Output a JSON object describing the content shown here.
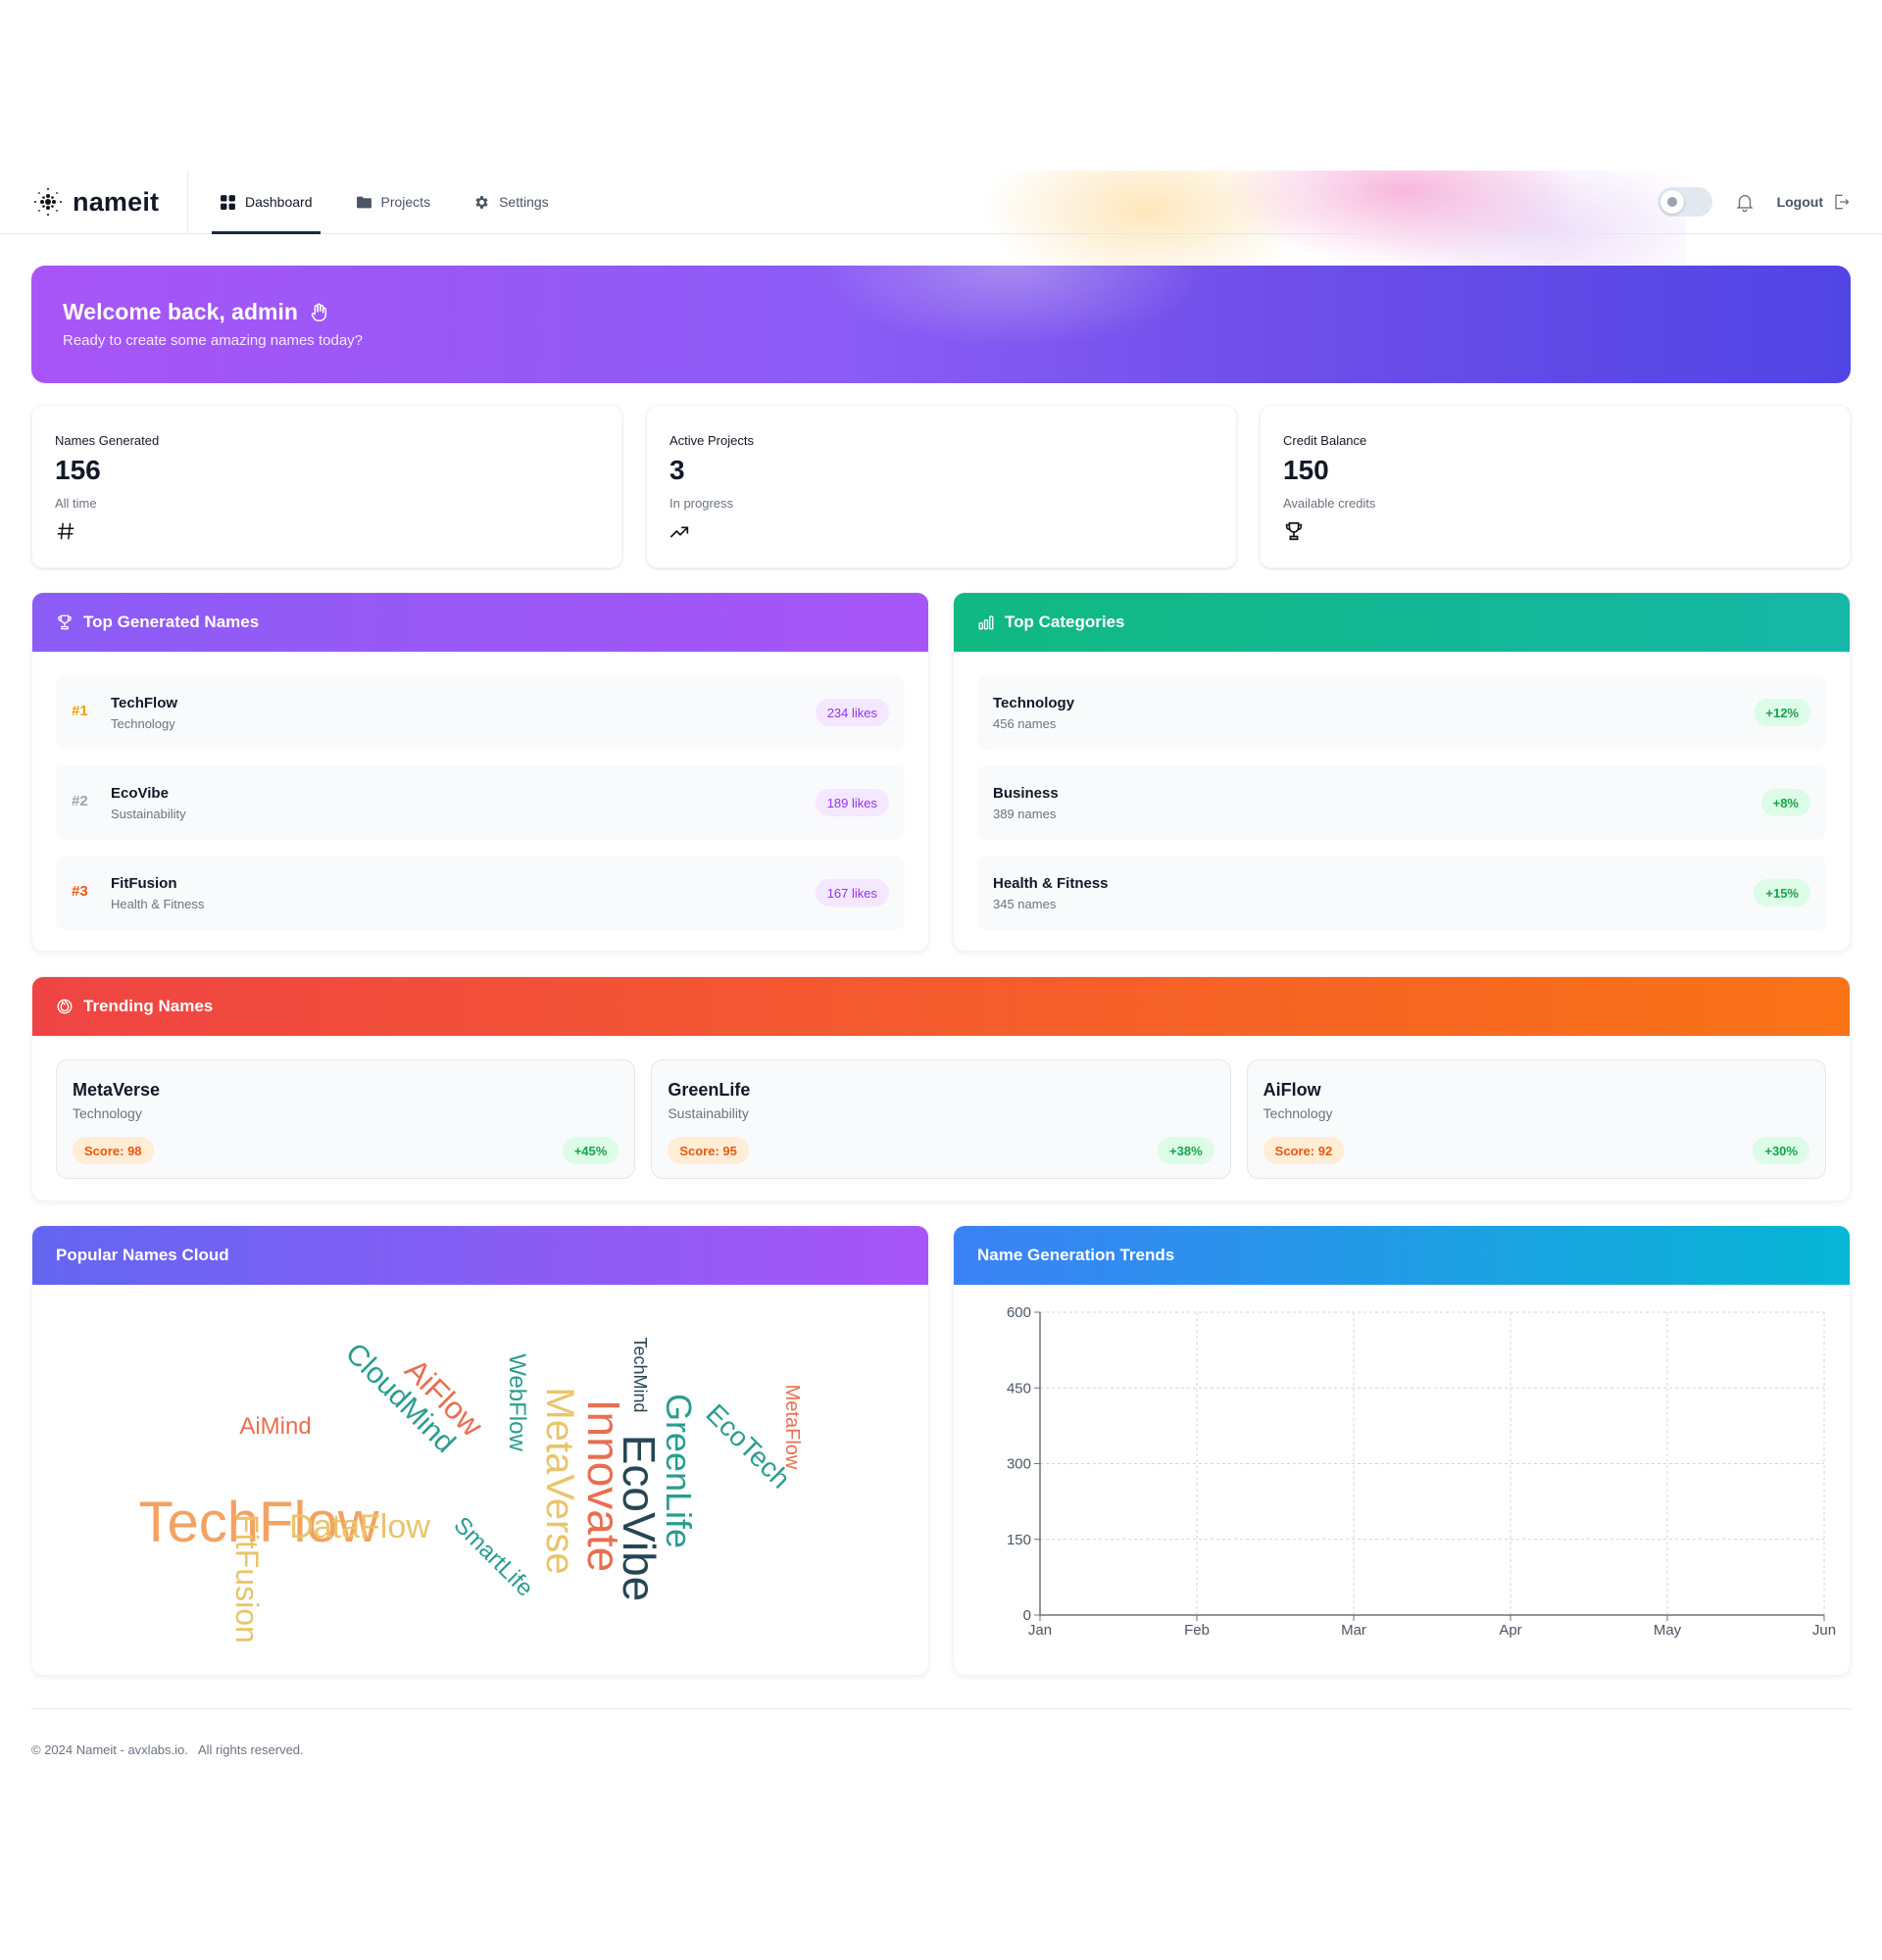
{
  "app": {
    "name": "nameit"
  },
  "nav": {
    "items": [
      {
        "label": "Dashboard",
        "icon": "grid-icon",
        "active": true
      },
      {
        "label": "Projects",
        "icon": "folder-icon",
        "active": false
      },
      {
        "label": "Settings",
        "icon": "gear-icon",
        "active": false
      }
    ],
    "logout_label": "Logout",
    "theme_toggle": "light"
  },
  "welcome": {
    "title": "Welcome back, admin",
    "subtitle": "Ready to create some amazing names today?",
    "icon": "waving-hand-icon"
  },
  "stats": [
    {
      "label": "Names Generated",
      "value": "156",
      "sub": "All time",
      "icon": "hash-icon"
    },
    {
      "label": "Active Projects",
      "value": "3",
      "sub": "In progress",
      "icon": "trending-up-icon"
    },
    {
      "label": "Credit Balance",
      "value": "150",
      "sub": "Available credits",
      "icon": "trophy-icon"
    }
  ],
  "top_names": {
    "title": "Top Generated Names",
    "items": [
      {
        "rank": "#1",
        "name": "TechFlow",
        "category": "Technology",
        "likes": "234 likes",
        "rank_color": "#f59e0b"
      },
      {
        "rank": "#2",
        "name": "EcoVibe",
        "category": "Sustainability",
        "likes": "189 likes",
        "rank_color": "#9ca3af"
      },
      {
        "rank": "#3",
        "name": "FitFusion",
        "category": "Health & Fitness",
        "likes": "167 likes",
        "rank_color": "#ea580c"
      }
    ]
  },
  "top_categories": {
    "title": "Top Categories",
    "items": [
      {
        "name": "Technology",
        "count": "456 names",
        "change": "+12%"
      },
      {
        "name": "Business",
        "count": "389 names",
        "change": "+8%"
      },
      {
        "name": "Health & Fitness",
        "count": "345 names",
        "change": "+15%"
      }
    ]
  },
  "trending": {
    "title": "Trending Names",
    "items": [
      {
        "name": "MetaVerse",
        "category": "Technology",
        "score": "Score: 98",
        "growth": "+45%"
      },
      {
        "name": "GreenLife",
        "category": "Sustainability",
        "score": "Score: 95",
        "growth": "+38%"
      },
      {
        "name": "AiFlow",
        "category": "Technology",
        "score": "Score: 92",
        "growth": "+30%"
      }
    ]
  },
  "cloud": {
    "title": "Popular Names Cloud",
    "colors": {
      "orange": "#f4a261",
      "red": "#e76f51",
      "yellow": "#e9c46a",
      "teal": "#2a9d8f",
      "navy": "#264653"
    },
    "words": [
      {
        "text": "TechFlow",
        "color": "orange"
      },
      {
        "text": "EcoVibe",
        "color": "navy"
      },
      {
        "text": "Innovate",
        "color": "red"
      },
      {
        "text": "MetaVerse",
        "color": "yellow"
      },
      {
        "text": "GreenLife",
        "color": "teal"
      },
      {
        "text": "AiFlow",
        "color": "red"
      },
      {
        "text": "CloudMind",
        "color": "teal"
      },
      {
        "text": "DataFlow",
        "color": "yellow"
      },
      {
        "text": "FitFusion",
        "color": "yellow"
      },
      {
        "text": "EcoTech",
        "color": "teal"
      },
      {
        "text": "SmartLife",
        "color": "teal"
      },
      {
        "text": "WebFlow",
        "color": "teal"
      },
      {
        "text": "AiMind",
        "color": "red"
      },
      {
        "text": "MetaFlow",
        "color": "red"
      },
      {
        "text": "TechMind",
        "color": "navy"
      }
    ]
  },
  "chart_data": {
    "type": "line",
    "title": "Name Generation Trends",
    "categories": [
      "Jan",
      "Feb",
      "Mar",
      "Apr",
      "May",
      "Jun"
    ],
    "series": [],
    "yticks": [
      "0",
      "150",
      "300",
      "450",
      "600"
    ],
    "ylim": [
      0,
      600
    ],
    "xlabel": "",
    "ylabel": "",
    "grid": true
  },
  "footer": {
    "text": "© 2024 Nameit - avxlabs.io.   All rights reserved."
  }
}
